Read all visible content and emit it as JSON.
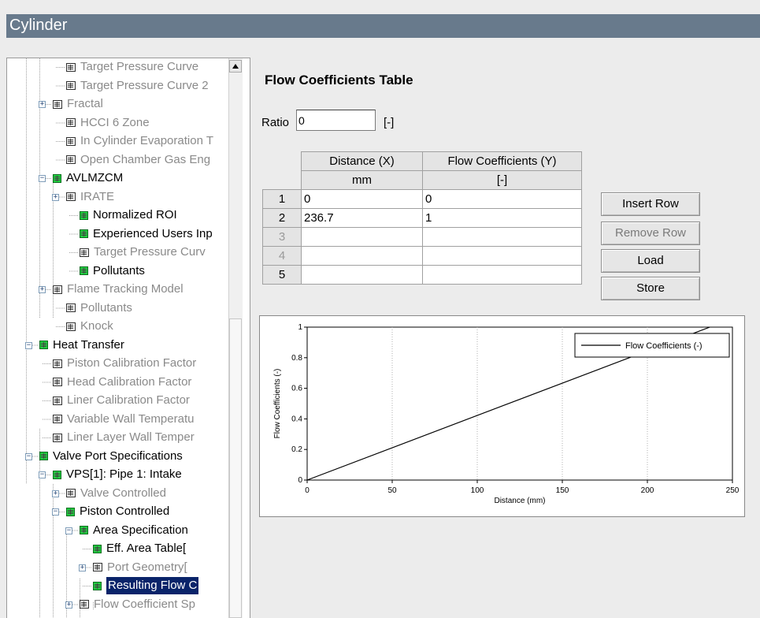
{
  "window": {
    "title": "Cylinder"
  },
  "tree": {
    "items": [
      {
        "label": "Target Pressure Curve",
        "gray": true,
        "icon": "table"
      },
      {
        "label": "Target Pressure Curve 2",
        "gray": true,
        "icon": "table"
      },
      {
        "label": "Fractal",
        "gray": true,
        "icon": "table",
        "expander": "+"
      },
      {
        "label": "HCCI 6 Zone",
        "gray": true,
        "icon": "table"
      },
      {
        "label": "In Cylinder Evaporation T",
        "gray": true,
        "icon": "table"
      },
      {
        "label": "Open Chamber Gas Eng",
        "gray": true,
        "icon": "table"
      },
      {
        "label": "AVLMZCM",
        "gray": false,
        "icon": "green",
        "expander": "-"
      },
      {
        "label": "IRATE",
        "gray": true,
        "icon": "table",
        "expander": "+"
      },
      {
        "label": "Normalized ROI",
        "gray": false,
        "icon": "green"
      },
      {
        "label": "Experienced Users Inp",
        "gray": false,
        "icon": "green"
      },
      {
        "label": "Target Pressure Curv",
        "gray": true,
        "icon": "table"
      },
      {
        "label": "Pollutants",
        "gray": false,
        "icon": "green"
      },
      {
        "label": "Flame Tracking Model",
        "gray": true,
        "icon": "table",
        "expander": "+"
      },
      {
        "label": "Pollutants",
        "gray": true,
        "icon": "table"
      },
      {
        "label": "Knock",
        "gray": true,
        "icon": "table"
      },
      {
        "label": "Heat Transfer",
        "gray": false,
        "icon": "green",
        "expander": "-"
      },
      {
        "label": "Piston Calibration Factor",
        "gray": true,
        "icon": "table"
      },
      {
        "label": "Head Calibration Factor",
        "gray": true,
        "icon": "table"
      },
      {
        "label": "Liner Calibration Factor",
        "gray": true,
        "icon": "table"
      },
      {
        "label": "Variable Wall Temperatu",
        "gray": true,
        "icon": "table"
      },
      {
        "label": "Liner Layer Wall Temper",
        "gray": true,
        "icon": "table"
      },
      {
        "label": "Valve Port Specifications",
        "gray": false,
        "icon": "green",
        "expander": "-"
      },
      {
        "label": "VPS[1]: Pipe 1: Intake",
        "gray": false,
        "icon": "green",
        "expander": "-"
      },
      {
        "label": "Valve Controlled",
        "gray": true,
        "icon": "table",
        "expander": "+"
      },
      {
        "label": "Piston Controlled",
        "gray": false,
        "icon": "green",
        "expander": "-"
      },
      {
        "label": "Area Specification",
        "gray": false,
        "icon": "green",
        "expander": "-"
      },
      {
        "label": "Eff. Area Table[",
        "gray": false,
        "icon": "green"
      },
      {
        "label": "Port Geometry[",
        "gray": true,
        "icon": "table",
        "expander": "+"
      },
      {
        "label": "Resulting Flow C",
        "gray": false,
        "icon": "green",
        "selected": true
      },
      {
        "label": "Flow Coefficient Sp",
        "gray": true,
        "icon": "table",
        "expander": "+"
      }
    ]
  },
  "main": {
    "heading": "Flow Coefficients Table",
    "ratio": {
      "label": "Ratio",
      "value": "0",
      "unit": "[-]"
    },
    "table": {
      "headers": [
        "Distance (X)",
        "Flow Coefficients (Y)"
      ],
      "units": [
        "mm",
        "[-]"
      ],
      "rows": [
        {
          "num": "1",
          "x": "0",
          "y": "0",
          "enabled": true
        },
        {
          "num": "2",
          "x": "236.7",
          "y": "1",
          "enabled": true
        },
        {
          "num": "3",
          "x": "",
          "y": "",
          "enabled": false
        },
        {
          "num": "4",
          "x": "",
          "y": "",
          "enabled": false
        },
        {
          "num": "5",
          "x": "",
          "y": "",
          "enabled": true
        }
      ]
    },
    "buttons": {
      "insert_row": "Insert Row",
      "remove_row": "Remove Row",
      "load": "Load",
      "store": "Store"
    }
  },
  "chart_data": {
    "type": "line",
    "xlabel": "Distance (mm)",
    "ylabel": "Flow Coefficients (-)",
    "xlim": [
      0,
      250
    ],
    "ylim": [
      0,
      1
    ],
    "xticks": [
      0,
      50,
      100,
      150,
      200,
      250
    ],
    "yticks": [
      0,
      0.2,
      0.4,
      0.6,
      0.8,
      1
    ],
    "ytick_labels": [
      "0",
      "0.2",
      "0.4",
      "0.6",
      "0.8",
      "1"
    ],
    "grid": "vertical dotted",
    "legend_position": "top-right",
    "series": [
      {
        "name": "Flow Coefficients (-)",
        "x": [
          0,
          236.7
        ],
        "y": [
          0,
          1
        ],
        "color": "#000000"
      }
    ]
  }
}
